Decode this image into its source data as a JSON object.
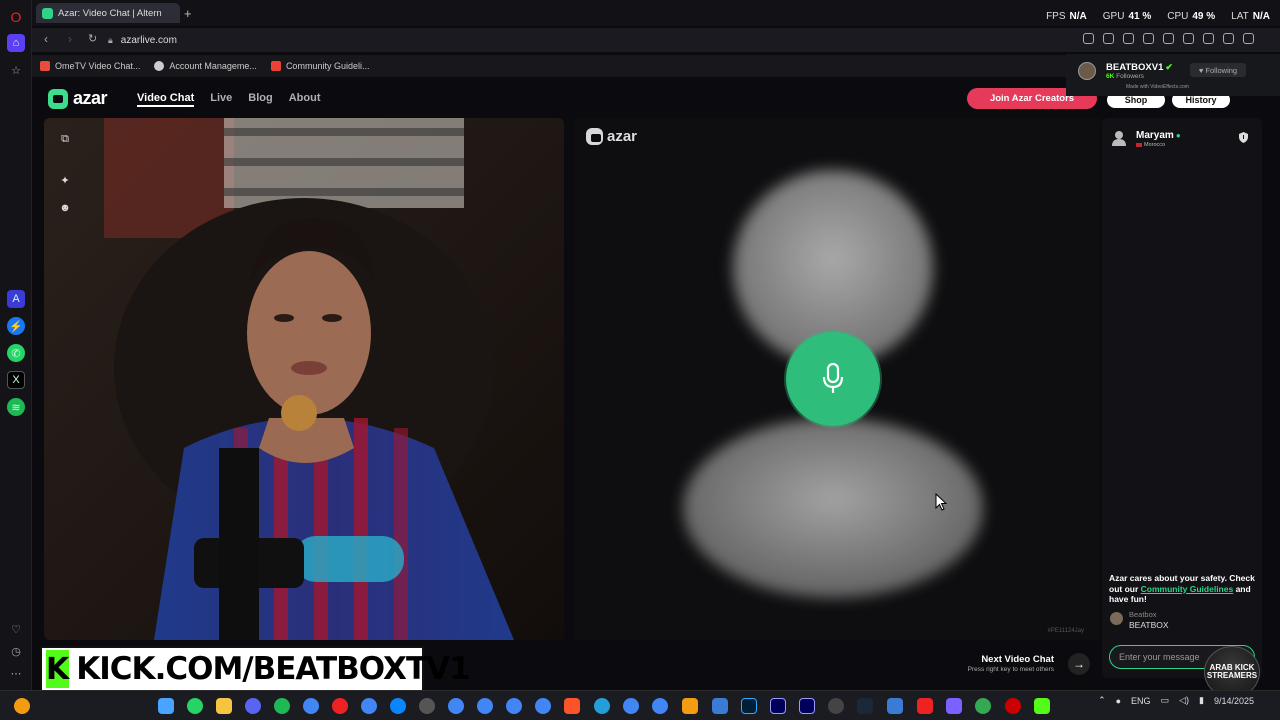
{
  "browser": {
    "tab_title": "Azar: Video Chat | Altern",
    "new_tab": "+",
    "url": "azarlive.com",
    "stats": [
      {
        "label": "FPS",
        "value": "N/A"
      },
      {
        "label": "GPU",
        "value": "41 %"
      },
      {
        "label": "CPU",
        "value": "49 %"
      },
      {
        "label": "LAT",
        "value": "N/A"
      }
    ],
    "bookmarks": [
      {
        "label": "OmeTV Video Chat...",
        "color": "#e74c3c"
      },
      {
        "label": "Account Manageme...",
        "color": "#cccccc"
      },
      {
        "label": "Community Guideli...",
        "color": "#ea4335"
      }
    ]
  },
  "site": {
    "brand": "azar",
    "nav": [
      "Video Chat",
      "Live",
      "Blog",
      "About"
    ],
    "join_label": "Join Azar Creators",
    "shop_label": "Shop",
    "history_label": "History",
    "accent": "#2fd48a",
    "join_color": "#e63a5a"
  },
  "kick_overlay": {
    "name": "BEATBOXV1",
    "followers": "6K",
    "followers_label": "Followers",
    "made_with": "Made with VideoEffects.com",
    "following_label": "Following",
    "brand_color": "#53fc18"
  },
  "remote": {
    "brand": "azar",
    "watermark": "#PE11124Jay"
  },
  "chat": {
    "partner_name": "Maryam",
    "partner_country": "Morocco",
    "safety_prefix": "Azar cares about your safety. Check out our ",
    "safety_link": "Community Guidelines",
    "safety_suffix": " and have fun!",
    "last_sender": "Beatbox",
    "last_message": "BEATBOX",
    "input_placeholder": "Enter your message"
  },
  "next_chat": {
    "title": "Next Video Chat",
    "subtitle": "Press right key to meet others"
  },
  "stream_banner": {
    "k": "K",
    "url": "KICK.COM/BEATBOXTV1"
  },
  "channel_logo": {
    "line1": "ARAB KICK",
    "line2": "STREAMERS"
  },
  "taskbar": {
    "lang": "ENG",
    "time": "",
    "date": "9/14/2025"
  }
}
